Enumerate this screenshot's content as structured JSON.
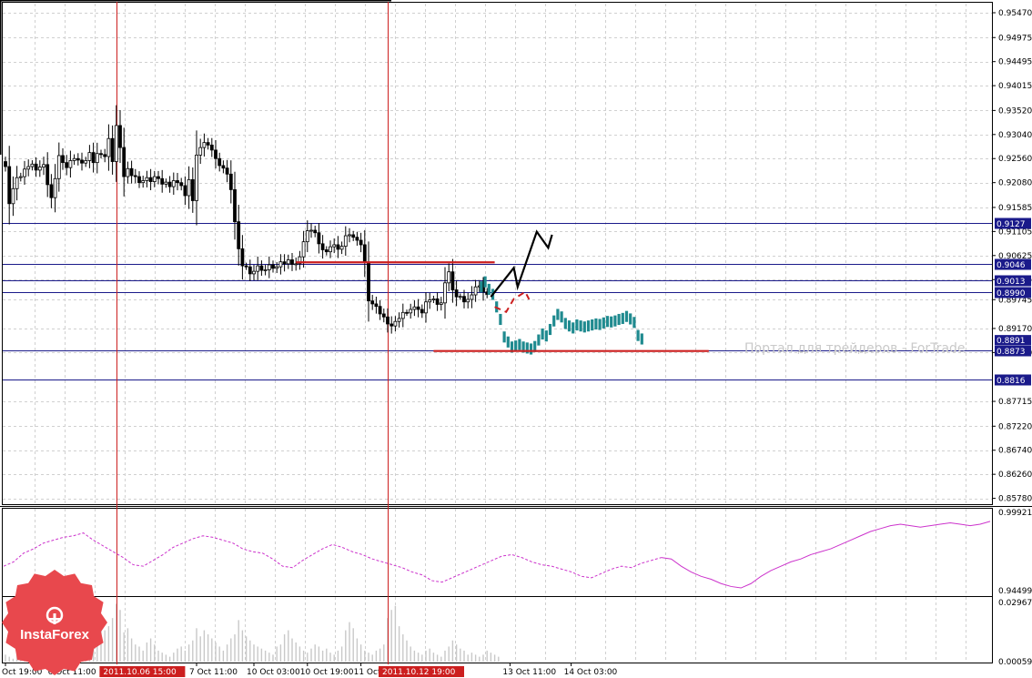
{
  "chart_data": [
    {
      "type": "candlestick",
      "panel": "main",
      "ylim": [
        0.857,
        0.9547
      ],
      "y_ticks": [
        "0.95470",
        "0.94975",
        "0.94495",
        "0.94015",
        "0.93520",
        "0.93040",
        "0.92560",
        "0.92080",
        "0.91585",
        "0.91105",
        "0.90625",
        "0.90145",
        "0.89745",
        "0.89170",
        "0.88690",
        "0.87715",
        "0.87220",
        "0.86740",
        "0.86260",
        "0.85780"
      ],
      "horizontal_levels": [
        {
          "label": "0.9127",
          "value": 0.9127
        },
        {
          "label": "0.9046",
          "value": 0.9046
        },
        {
          "label": "0.9013",
          "value": 0.9013
        },
        {
          "label": "0.8990",
          "value": 0.899
        },
        {
          "label": "0.8873",
          "value": 0.8873
        },
        {
          "label": "0.8816",
          "value": 0.8816
        }
      ],
      "current_price_label": "0.8891",
      "support_resistance": [
        {
          "value": 0.9049,
          "from_bar": 76,
          "to_bar": 128,
          "color": "#cc1f1f"
        },
        {
          "value": 0.8872,
          "from_bar": 112,
          "to_bar": 184,
          "color": "#cc1f1f"
        }
      ],
      "vertical_markers": [
        29,
        100
      ],
      "close": [
        0.924,
        0.9166,
        0.9196,
        0.9218,
        0.922,
        0.9235,
        0.924,
        0.9245,
        0.9233,
        0.9239,
        0.9244,
        0.9204,
        0.9178,
        0.9216,
        0.9262,
        0.9248,
        0.9238,
        0.9252,
        0.9256,
        0.9253,
        0.9247,
        0.9252,
        0.9268,
        0.9248,
        0.9266,
        0.9264,
        0.926,
        0.9296,
        0.925,
        0.9322,
        0.9278,
        0.922,
        0.9236,
        0.9222,
        0.922,
        0.9208,
        0.9212,
        0.9218,
        0.921,
        0.922,
        0.9216,
        0.9205,
        0.9209,
        0.92,
        0.9212,
        0.9208,
        0.9202,
        0.9182,
        0.9214,
        0.9172,
        0.9263,
        0.9278,
        0.9288,
        0.9283,
        0.9273,
        0.9256,
        0.9242,
        0.9237,
        0.9225,
        0.9194,
        0.913,
        0.9076,
        0.9042,
        0.904,
        0.9026,
        0.9031,
        0.9042,
        0.9033,
        0.9034,
        0.9044,
        0.9037,
        0.904,
        0.905,
        0.9046,
        0.9054,
        0.9045,
        0.9046,
        0.906,
        0.909,
        0.9112,
        0.9113,
        0.9108,
        0.9086,
        0.9074,
        0.907,
        0.908,
        0.9084,
        0.9075,
        0.9081,
        0.9102,
        0.9104,
        0.9099,
        0.9093,
        0.9084,
        0.9049,
        0.8972,
        0.8966,
        0.8961,
        0.8946,
        0.894,
        0.8926,
        0.8922,
        0.8931,
        0.8937,
        0.8949,
        0.8948,
        0.8955,
        0.896,
        0.8955,
        0.8948,
        0.897,
        0.8974,
        0.8976,
        0.8965,
        0.8968,
        0.9008,
        0.903,
        0.8994,
        0.898,
        0.8981,
        0.897,
        0.8975,
        0.8984,
        0.9,
        0.9002,
        0.899,
        0.8985
      ],
      "forecast_bars": [
        0.9,
        0.901,
        0.8995,
        0.8985,
        0.896,
        0.8935,
        0.89,
        0.889,
        0.888,
        0.8882,
        0.8885,
        0.888,
        0.8878,
        0.8876,
        0.8881,
        0.8894,
        0.8906,
        0.8902,
        0.8915,
        0.8932,
        0.8945,
        0.894,
        0.8927,
        0.8922,
        0.8918,
        0.8924,
        0.8922,
        0.892,
        0.8922,
        0.8924,
        0.8926,
        0.8925,
        0.8928,
        0.8931,
        0.893,
        0.8932,
        0.8935,
        0.8937,
        0.8941,
        0.8936,
        0.8929,
        0.8903,
        0.8896
      ],
      "forecast_path": [
        [
          0.898
        ],
        [
          0.9038
        ],
        [
          0.9
        ],
        [
          0.911
        ],
        [
          0.9078
        ]
      ],
      "forecast_path_bars": [
        127,
        133,
        134,
        139,
        142,
        143
      ],
      "forecast_path_values": [
        0.898,
        0.9038,
        0.9,
        0.911,
        0.9078,
        0.9104
      ]
    },
    {
      "type": "line",
      "panel": "indicator",
      "ylim": [
        0.9445,
        0.9992
      ],
      "y_ticks": [
        "0.99921",
        "0.94499"
      ],
      "color": "#cc33cc",
      "values": [
        0.962,
        0.965,
        0.971,
        0.974,
        0.978,
        0.98,
        0.982,
        0.983,
        0.985,
        0.98,
        0.976,
        0.972,
        0.968,
        0.963,
        0.962,
        0.966,
        0.97,
        0.975,
        0.978,
        0.981,
        0.983,
        0.982,
        0.98,
        0.978,
        0.974,
        0.972,
        0.971,
        0.967,
        0.962,
        0.961,
        0.966,
        0.97,
        0.974,
        0.977,
        0.975,
        0.972,
        0.97,
        0.967,
        0.965,
        0.963,
        0.961,
        0.958,
        0.956,
        0.952,
        0.951,
        0.954,
        0.957,
        0.96,
        0.963,
        0.966,
        0.969,
        0.97,
        0.968,
        0.965,
        0.963,
        0.962,
        0.96,
        0.958,
        0.955,
        0.954,
        0.957,
        0.96,
        0.962,
        0.961,
        0.964,
        0.966,
        0.968,
        0.967,
        0.962,
        0.958,
        0.955,
        0.953,
        0.95,
        0.948,
        0.947,
        0.95,
        0.955,
        0.959,
        0.962,
        0.965,
        0.967,
        0.97,
        0.972,
        0.974,
        0.977,
        0.98,
        0.983,
        0.986,
        0.988,
        0.99,
        0.991,
        0.99,
        0.989,
        0.99,
        0.991,
        0.992,
        0.991,
        0.99,
        0.991,
        0.993
      ]
    },
    {
      "type": "bar",
      "panel": "volume",
      "ylim": [
        0.00059,
        0.02967
      ],
      "y_ticks": [
        "0.02967",
        "0.00059"
      ],
      "color": "#c8c8c8",
      "values": [
        0.004,
        0.003,
        0.002,
        0.006,
        0.003,
        0.005,
        0.004,
        0.003,
        0.002,
        0.005,
        0.004,
        0.003,
        0.006,
        0.004,
        0.005,
        0.003,
        0.002,
        0.004,
        0.008,
        0.006,
        0.012,
        0.009,
        0.013,
        0.011,
        0.01,
        0.02,
        0.016,
        0.018,
        0.022,
        0.029,
        0.026,
        0.015,
        0.017,
        0.012,
        0.009,
        0.008,
        0.006,
        0.01,
        0.012,
        0.009,
        0.006,
        0.005,
        0.004,
        0.003,
        0.005,
        0.007,
        0.008,
        0.006,
        0.009,
        0.011,
        0.017,
        0.013,
        0.016,
        0.014,
        0.012,
        0.01,
        0.008,
        0.006,
        0.009,
        0.012,
        0.014,
        0.021,
        0.016,
        0.013,
        0.011,
        0.009,
        0.008,
        0.007,
        0.006,
        0.005,
        0.004,
        0.008,
        0.009,
        0.014,
        0.016,
        0.012,
        0.01,
        0.008,
        0.006,
        0.005,
        0.007,
        0.009,
        0.008,
        0.006,
        0.007,
        0.005,
        0.004,
        0.006,
        0.008,
        0.016,
        0.02,
        0.017,
        0.012,
        0.009,
        0.006,
        0.005,
        0.004,
        0.006,
        0.007,
        0.009,
        0.022,
        0.026,
        0.028,
        0.018,
        0.014,
        0.011,
        0.008,
        0.006,
        0.005,
        0.004,
        0.006,
        0.007,
        0.005,
        0.004,
        0.003,
        0.006,
        0.008,
        0.011,
        0.009,
        0.007,
        0.006,
        0.004,
        0.005,
        0.004,
        0.003,
        0.004,
        0.006,
        0.005,
        0.004,
        0.003
      ]
    }
  ],
  "x_axis": {
    "labels": [
      {
        "bar": 0,
        "text": "Oct 19:00",
        "highlight": false
      },
      {
        "bar": 13,
        "text": "6 Oct 11:00",
        "highlight": false
      },
      {
        "bar": 27,
        "text": "2011.10.06 15:00",
        "highlight": true
      },
      {
        "bar": 50,
        "text": "7 Oct 11:00",
        "highlight": false
      },
      {
        "bar": 65,
        "text": "10 Oct 03:00",
        "highlight": false
      },
      {
        "bar": 79,
        "text": "10 Oct 19:00",
        "highlight": false
      },
      {
        "bar": 93,
        "text": "11 Oct 11:00",
        "highlight": false
      },
      {
        "bar": 100,
        "text": "2011.10.12 19:00",
        "highlight": true
      },
      {
        "bar": 132,
        "text": "13 Oct 11:00",
        "highlight": false
      },
      {
        "bar": 148,
        "text": "14 Oct 03:00",
        "highlight": false
      }
    ],
    "hidden_partial": [
      "9:00",
      "12 C",
      "00"
    ]
  },
  "watermark": "Портал для трейдеров - ForTrade",
  "logo": {
    "text": "InstaForex",
    "color": "#e8484d"
  },
  "colors": {
    "grid": "#d0d0d0",
    "level_line": "#1a1a8a",
    "label_bg": "#1a1a8a",
    "candles": "#000000",
    "forecast": "#1f8a8f",
    "marker_line": "#cc1f1f"
  }
}
